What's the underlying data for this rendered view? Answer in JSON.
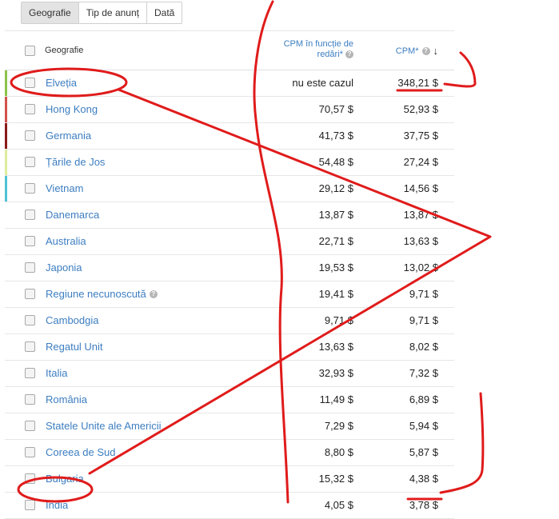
{
  "tabs": [
    {
      "label": "Geografie",
      "active": true
    },
    {
      "label": "Tip de anunț",
      "active": false
    },
    {
      "label": "Dată",
      "active": false
    }
  ],
  "table": {
    "headers": {
      "geography": "Geografie",
      "cpm_render": "CPM în funcție de redări*",
      "cpm": "CPM*"
    },
    "rows": [
      {
        "name": "Elveția",
        "cpm_render": "nu este cazul",
        "cpm": "348,21 $",
        "stripe": "#8bc34a"
      },
      {
        "name": "Hong Kong",
        "cpm_render": "70,57 $",
        "cpm": "52,93 $",
        "stripe": "#d0524a"
      },
      {
        "name": "Germania",
        "cpm_render": "41,73 $",
        "cpm": "37,75 $",
        "stripe": "#8b1a1a"
      },
      {
        "name": "Țările de Jos",
        "cpm_render": "54,48 $",
        "cpm": "27,24 $",
        "stripe": "#dcee9c"
      },
      {
        "name": "Vietnam",
        "cpm_render": "29,12 $",
        "cpm": "14,56 $",
        "stripe": "#4fc3d6"
      },
      {
        "name": "Danemarca",
        "cpm_render": "13,87 $",
        "cpm": "13,87 $",
        "stripe": ""
      },
      {
        "name": "Australia",
        "cpm_render": "22,71 $",
        "cpm": "13,63 $",
        "stripe": ""
      },
      {
        "name": "Japonia",
        "cpm_render": "19,53 $",
        "cpm": "13,02 $",
        "stripe": ""
      },
      {
        "name": "Regiune necunoscută",
        "cpm_render": "19,41 $",
        "cpm": "9,71 $",
        "stripe": "",
        "help": true
      },
      {
        "name": "Cambodgia",
        "cpm_render": "9,71 $",
        "cpm": "9,71 $",
        "stripe": ""
      },
      {
        "name": "Regatul Unit",
        "cpm_render": "13,63 $",
        "cpm": "8,02 $",
        "stripe": ""
      },
      {
        "name": "Italia",
        "cpm_render": "32,93 $",
        "cpm": "7,32 $",
        "stripe": ""
      },
      {
        "name": "România",
        "cpm_render": "11,49 $",
        "cpm": "6,89 $",
        "stripe": ""
      },
      {
        "name": "Statele Unite ale Americii",
        "cpm_render": "7,29 $",
        "cpm": "5,94 $",
        "stripe": ""
      },
      {
        "name": "Coreea de Sud",
        "cpm_render": "8,80 $",
        "cpm": "5,87 $",
        "stripe": ""
      },
      {
        "name": "Bulgaria",
        "cpm_render": "15,32 $",
        "cpm": "4,38 $",
        "stripe": ""
      },
      {
        "name": "India",
        "cpm_render": "4,05 $",
        "cpm": "3,78 $",
        "stripe": ""
      }
    ]
  },
  "colors": {
    "link": "#3d7ec1",
    "annotation": "#e01b1b"
  }
}
